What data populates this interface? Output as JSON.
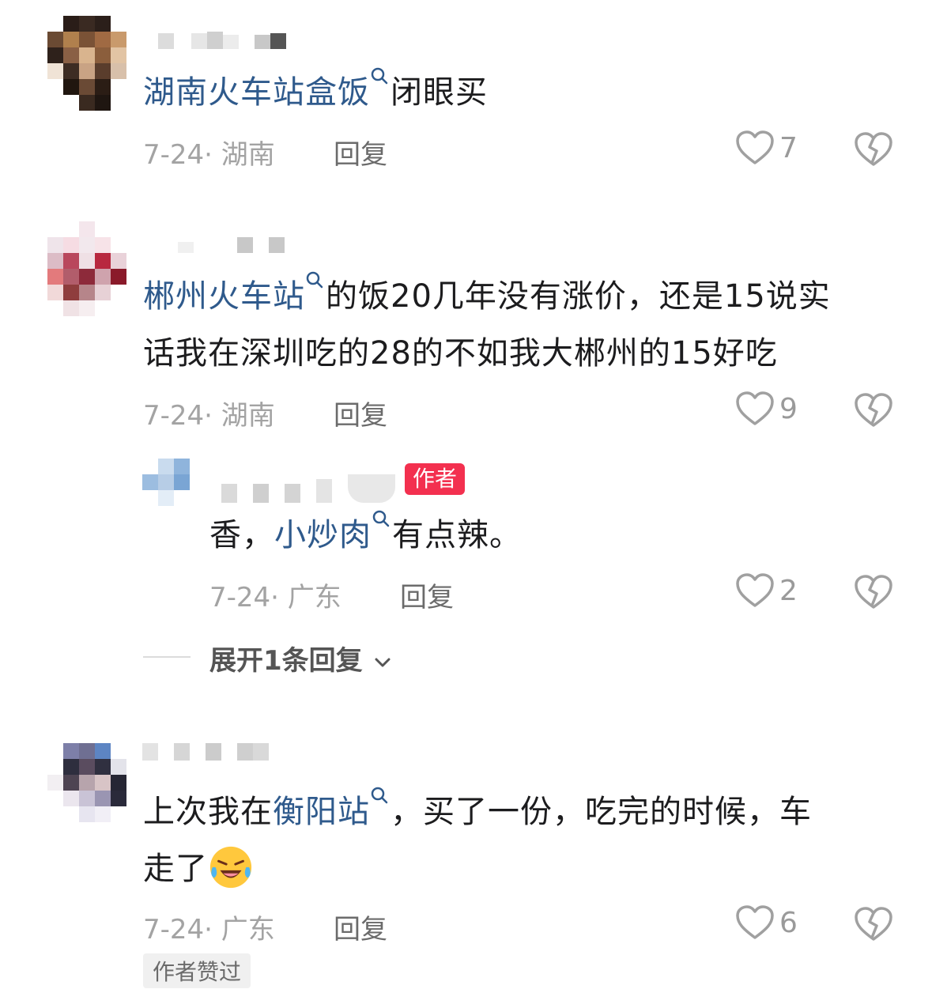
{
  "comments": [
    {
      "text_link": "湖南火车站盒饭",
      "text_rest": "闭眼买",
      "date": "7-24",
      "location": "湖南",
      "reply_label": "回复",
      "likes": "7"
    },
    {
      "text_link": "郴州火车站",
      "text_rest_line1": "的饭20几年没有涨价，还是15说实",
      "text_line2": "话我在深圳吃的28的不如我大郴州的15好吃",
      "date": "7-24",
      "location": "湖南",
      "reply_label": "回复",
      "likes": "9"
    },
    {
      "is_reply": true,
      "badge": "作者",
      "text_pre": "香，",
      "text_link": "小炒肉",
      "text_rest": "有点辣。",
      "date": "7-24",
      "location": "广东",
      "reply_label": "回复",
      "likes": "2"
    },
    {
      "text_pre": "上次我在",
      "text_link": "衡阳站",
      "text_rest_line1": "，买了一份，吃完的时候，车",
      "text_line2": "走了",
      "date": "7-24",
      "location": "广东",
      "reply_label": "回复",
      "likes": "6",
      "author_liked": "作者赞过"
    }
  ],
  "expand_replies": "展开1条回复",
  "icons": [
    "search-icon",
    "heart-icon",
    "broken-heart-icon",
    "chevron-down-icon",
    "laughing-crying-emoji"
  ],
  "colors": {
    "link": "#2f5a8c",
    "badge": "#f3304f",
    "meta": "#a3a3a3"
  }
}
